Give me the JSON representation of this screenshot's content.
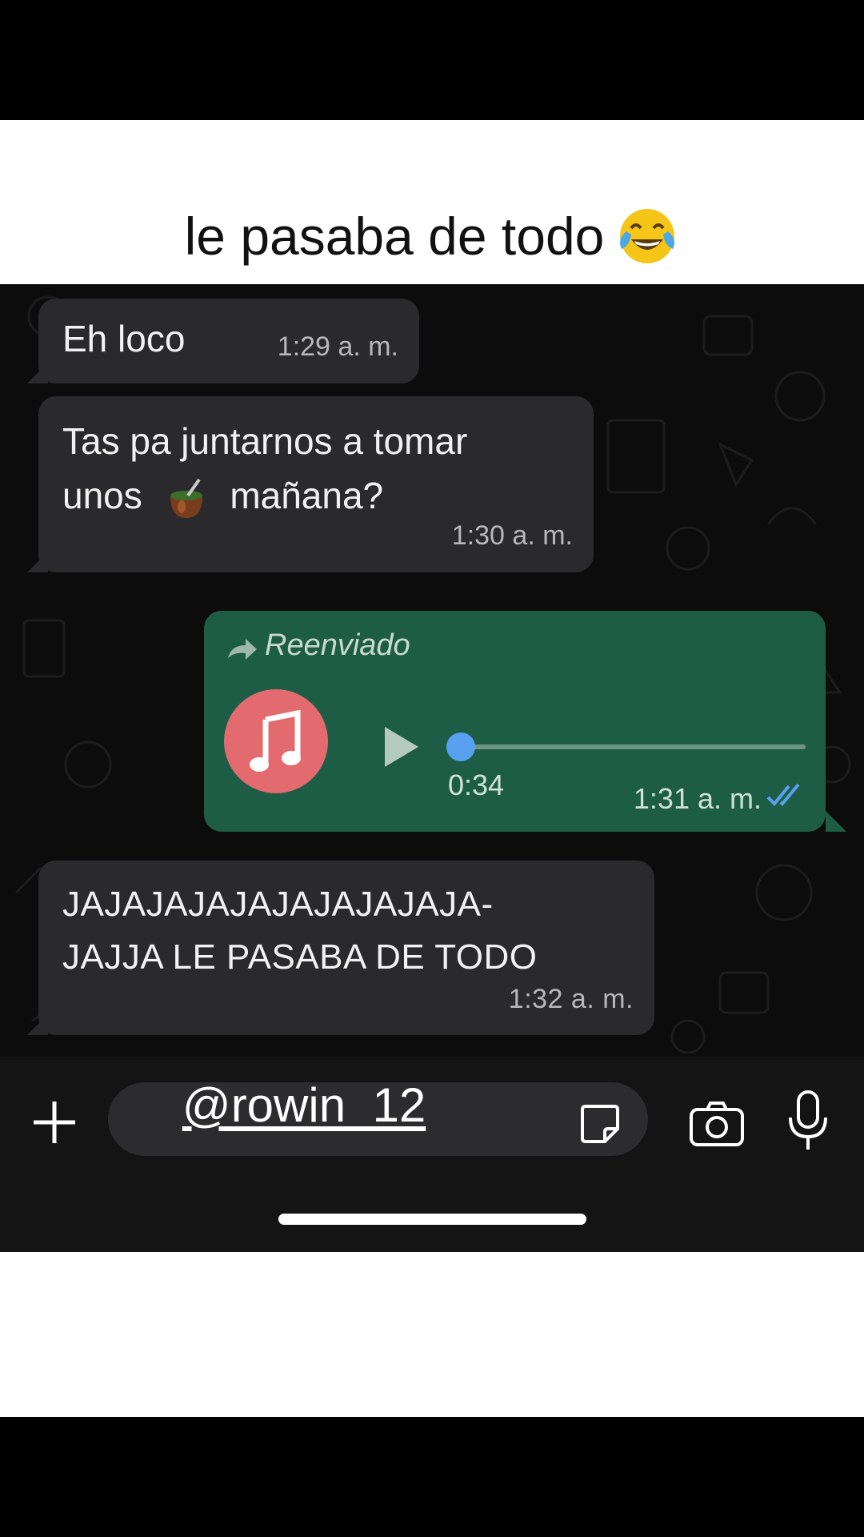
{
  "caption": {
    "text": "le pasaba de todo",
    "emoji_icon": "tears-of-joy-emoji-icon"
  },
  "messages": [
    {
      "direction": "incoming",
      "text": "Eh loco",
      "time": "1:29 a. m."
    },
    {
      "direction": "incoming",
      "line1": "Tas pa juntarnos a tomar",
      "line2_before": "unos",
      "line2_after": "mañana?",
      "inline_icon": "mate-gourd-icon",
      "time": "1:30 a. m."
    },
    {
      "direction": "outgoing",
      "forwarded_label": "Reenviado",
      "type": "audio",
      "duration": "0:34",
      "progress": 0.0,
      "time": "1:31 a. m.",
      "status": "read"
    },
    {
      "direction": "incoming",
      "line1": "JAJAJAJAJAJAJAJAJAJA-",
      "line2": "JAJJA LE PASABA DE TODO",
      "time": "1:32 a. m."
    }
  ],
  "input_bar": {
    "overlay_handle": "@rowin_12",
    "icons": [
      "plus-icon",
      "sticker-icon",
      "camera-icon",
      "microphone-icon"
    ]
  },
  "colors": {
    "incoming_bubble": "#2a2a2c",
    "outgoing_bubble": "#1e5d45",
    "audio_avatar": "#e36a6e",
    "progress_dot": "#5aa0f0",
    "read_ticks": "#5aa0f0"
  }
}
